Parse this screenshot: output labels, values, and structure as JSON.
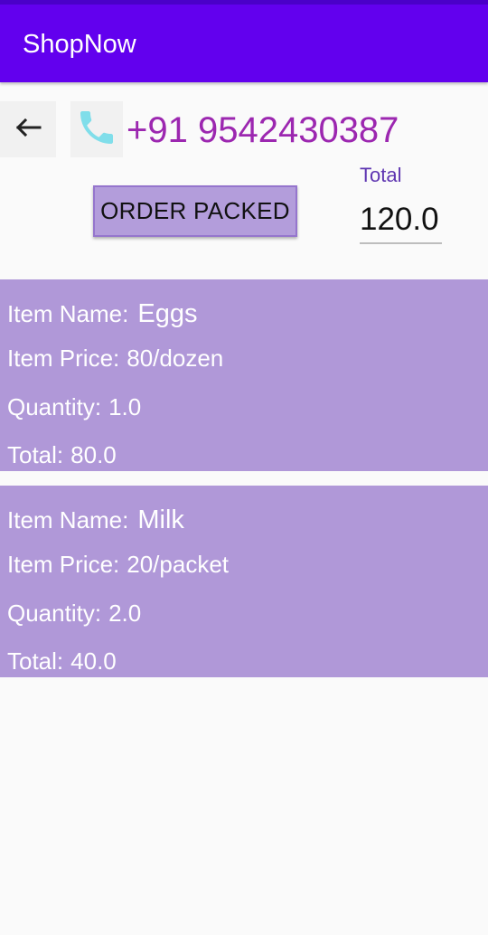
{
  "app": {
    "title": "ShopNow",
    "accent_color": "#6200ee",
    "card_color": "#b098d8"
  },
  "header": {
    "back_icon": "arrow-left-icon",
    "call_icon": "phone-icon",
    "phone_number": "+91 9542430387"
  },
  "actions": {
    "order_packed_label": "ORDER PACKED"
  },
  "summary": {
    "total_label": "Total",
    "total_value": "120.0"
  },
  "labels": {
    "item_name": "Item Name:",
    "item_price": "Item Price:",
    "quantity": "Quantity:",
    "total": "Total:"
  },
  "items": [
    {
      "name": "Eggs",
      "price": "80/dozen",
      "quantity": "1.0",
      "total": "80.0"
    },
    {
      "name": "Milk",
      "price": "20/packet",
      "quantity": "2.0",
      "total": "40.0"
    }
  ]
}
